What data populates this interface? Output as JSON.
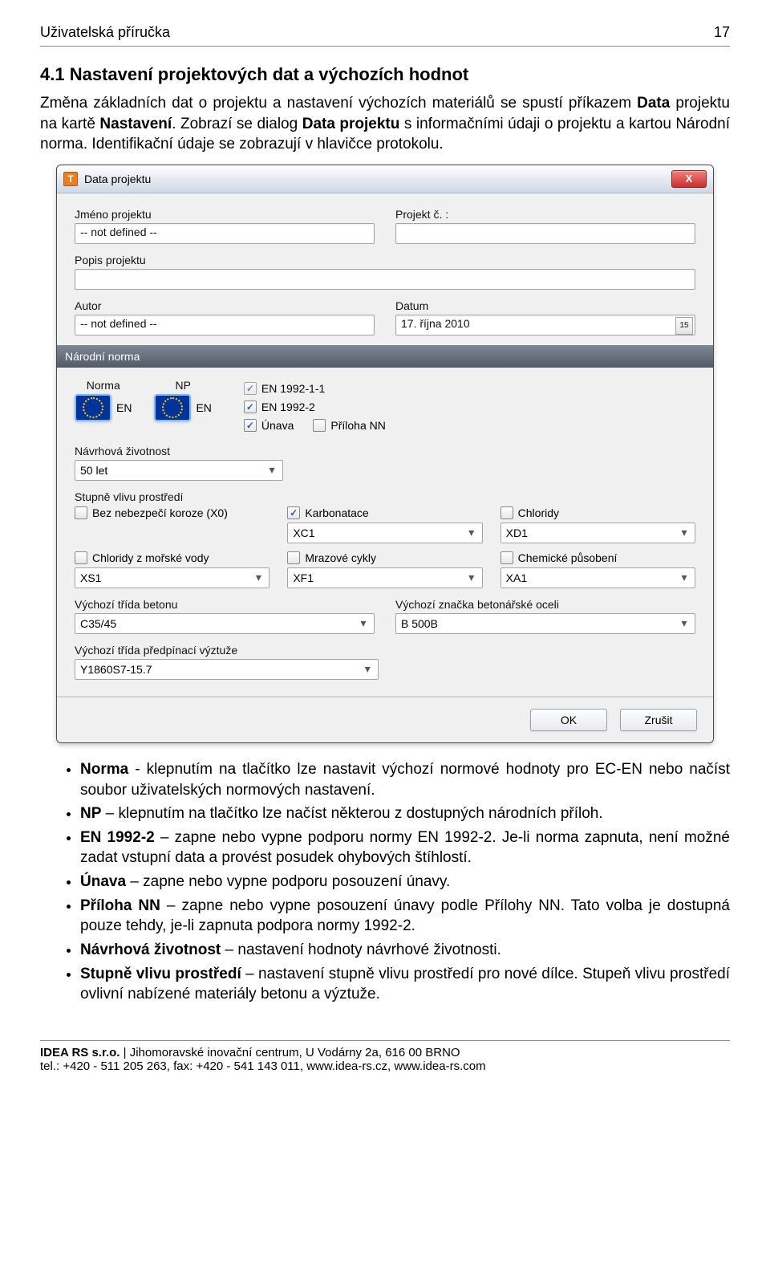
{
  "doc_header": {
    "title": "Uživatelská příručka",
    "page": "17"
  },
  "section_heading": "4.1 Nastavení projektových dat a výchozích hodnot",
  "para1_a": "Změna základních dat o projektu a nastavení výchozích materiálů se spustí příkazem ",
  "para1_b": "Data",
  "para1_c": " projektu na kartě ",
  "para1_d": "Nastavení",
  "para1_e": ". Zobrazí se dialog ",
  "para1_f": "Data projektu",
  "para1_g": " s informačními údaji o projektu a kartou Národní norma. Identifikační údaje se zobrazují v hlavičce protokolu.",
  "dialog": {
    "title": "Data projektu",
    "close_label": "X",
    "project_name_label": "Jméno projektu",
    "project_name_value": "-- not defined --",
    "project_no_label": "Projekt č. :",
    "project_no_value": "",
    "project_desc_label": "Popis projektu",
    "project_desc_value": "",
    "author_label": "Autor",
    "author_value": "-- not defined --",
    "date_label": "Datum",
    "date_value": "17. října 2010",
    "national_norm_header": "Národní norma",
    "norma_label": "Norma",
    "np_label": "NP",
    "norma_btn_text": "EN",
    "np_btn_text": "EN",
    "ck_en19921_1": "EN 1992-1-1",
    "ck_en19922": "EN 1992-2",
    "ck_unava": "Únava",
    "ck_priloha": "Příloha NN",
    "life_label": "Návrhová životnost",
    "life_value": "50 let",
    "env_header": "Stupně vlivu prostředí",
    "env": {
      "x0": {
        "h": "Bez nebezpečí koroze (X0)",
        "v": ""
      },
      "karb": {
        "h": "Karbonatace",
        "v": "XC1"
      },
      "chlor": {
        "h": "Chloridy",
        "v": "XD1"
      },
      "sea": {
        "h": "Chloridy z mořské vody",
        "v": "XS1"
      },
      "frost": {
        "h": "Mrazové cykly",
        "v": "XF1"
      },
      "chem": {
        "h": "Chemické působení",
        "v": "XA1"
      }
    },
    "concrete_label": "Výchozí třída betonu",
    "concrete_value": "C35/45",
    "steel_label": "Výchozí značka betonářské oceli",
    "steel_value": "B 500B",
    "prestress_label": "Výchozí třída předpínací výztuže",
    "prestress_value": "Y1860S7-15.7",
    "ok": "OK",
    "cancel": "Zrušit"
  },
  "bullets": {
    "b1a": "Norma",
    "b1b": "  - klepnutím na tlačítko lze nastavit výchozí normové hodnoty pro EC-EN nebo načíst soubor uživatelských normových nastavení.",
    "b2a": "NP",
    "b2b": " – klepnutím na tlačítko lze načíst některou z dostupných národních příloh.",
    "b3a": "EN 1992-2",
    "b3b": " – zapne nebo vypne podporu normy EN 1992-2. Je-li norma zapnuta, není možné zadat vstupní data a provést posudek   ohybových štíhlostí.",
    "b4a": "Únava",
    "b4b": " – zapne nebo vypne podporu posouzení únavy.",
    "b5a": "Příloha NN",
    "b5b": " – zapne nebo vypne posouzení únavy podle Přílohy NN. Tato volba je dostupná pouze tehdy, je-li zapnuta podpora normy 1992-2.",
    "b6a": "Návrhová životnost",
    "b6b": " – nastavení hodnoty návrhové životnosti.",
    "b7a": "Stupně vlivu prostředí",
    "b7b": " – nastavení stupně vlivu prostředí pro nové dílce. Stupeň vlivu prostředí ovlivní nabízené materiály betonu a výztuže."
  },
  "footer": {
    "l1a": "IDEA RS s.r.o.",
    "l1b": " | Jihomoravské inovační centrum, U Vodárny 2a, 616 00 BRNO",
    "l2": "tel.: +420 - 511 205 263, fax: +420 - 541 143 011, www.idea-rs.cz, www.idea-rs.com"
  }
}
